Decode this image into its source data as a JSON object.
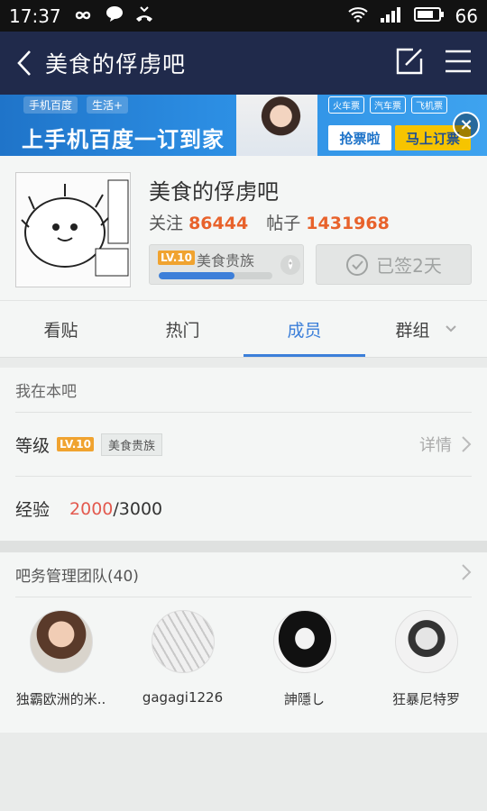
{
  "status_bar": {
    "time": "17:37",
    "battery": "66",
    "icons": [
      "infinity-icon",
      "chat-bubble-icon",
      "missed-call-icon",
      "wifi-icon",
      "signal-icon",
      "battery-icon"
    ]
  },
  "nav": {
    "back_icon": "chevron-left-icon",
    "title": "美食的俘虏吧",
    "actions": [
      "edit-icon",
      "menu-icon"
    ]
  },
  "banner": {
    "top_left": [
      "手机百度",
      "生活+"
    ],
    "headline": "上手机百度一订到家",
    "mini_tags": [
      "火车票",
      "汽车票",
      "飞机票"
    ],
    "btn_grab": "抢票啦",
    "btn_book": "马上订票",
    "close_icon": "close-circle-icon"
  },
  "forum": {
    "name": "美食的俘虏吧",
    "follow_label": "关注",
    "follow_count": "86444",
    "posts_label": "帖子",
    "posts_count": "1431968",
    "level_badge": "LV.10",
    "level_name": "美食贵族",
    "level_progress": 0.667,
    "signed_label": "已签2天"
  },
  "tabs": [
    {
      "label": "看贴",
      "active": false
    },
    {
      "label": "热门",
      "active": false
    },
    {
      "label": "成员",
      "active": true
    },
    {
      "label": "群组",
      "active": false
    }
  ],
  "my_section": {
    "title": "我在本吧",
    "level_label": "等级",
    "level_badge": "LV.10",
    "level_name": "美食贵族",
    "detail_label": "详情",
    "exp_label": "经验",
    "exp_current": "2000",
    "exp_total": "/3000"
  },
  "team": {
    "title": "吧务管理团队(40)",
    "members": [
      {
        "name": "独霸欧洲的米.."
      },
      {
        "name": "gagagi1226"
      },
      {
        "name": "訷隱し"
      },
      {
        "name": "狂暴尼特罗"
      }
    ]
  },
  "colors": {
    "nav_bg": "#202a4b",
    "accent_blue": "#3b7fd9",
    "count_orange": "#e8622b",
    "exp_red": "#e35a4f",
    "level_badge": "#f0a330"
  }
}
